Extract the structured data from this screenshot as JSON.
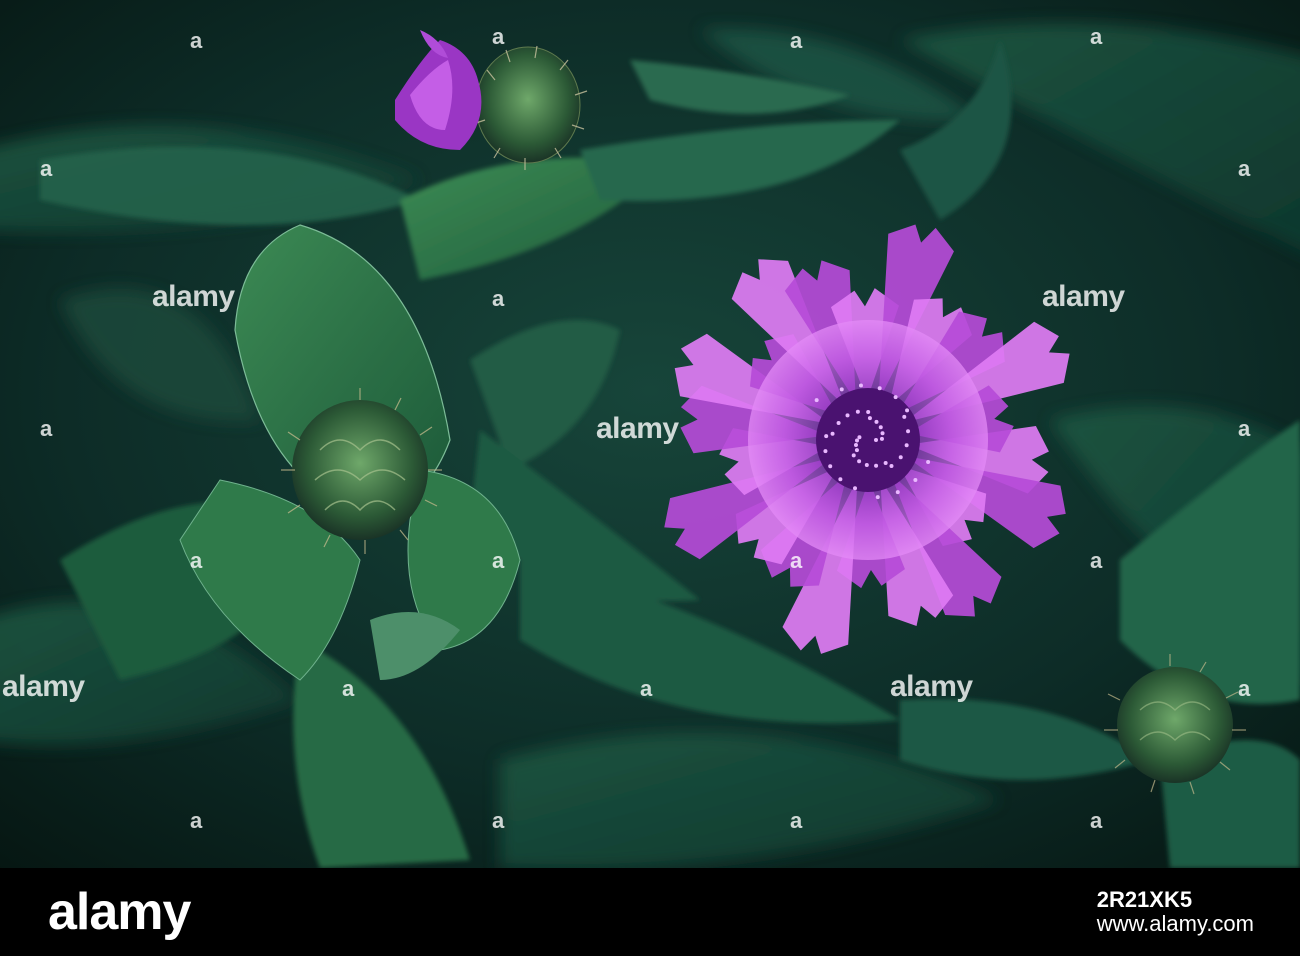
{
  "photo": {
    "subject": "purple cornflower with buds among green leaves",
    "watermark_text": "alamy",
    "watermark_letter": "a",
    "colors": {
      "background": "#0b2420",
      "leaf": "#2f7a45",
      "leaf_light": "#4f9a6a",
      "petal": "#b64bd8",
      "petal_light": "#e07cf4",
      "center": "#4a1270"
    }
  },
  "footer": {
    "logo": "alamy",
    "image_id": "2R21XK5",
    "site": "www.alamy.com"
  }
}
